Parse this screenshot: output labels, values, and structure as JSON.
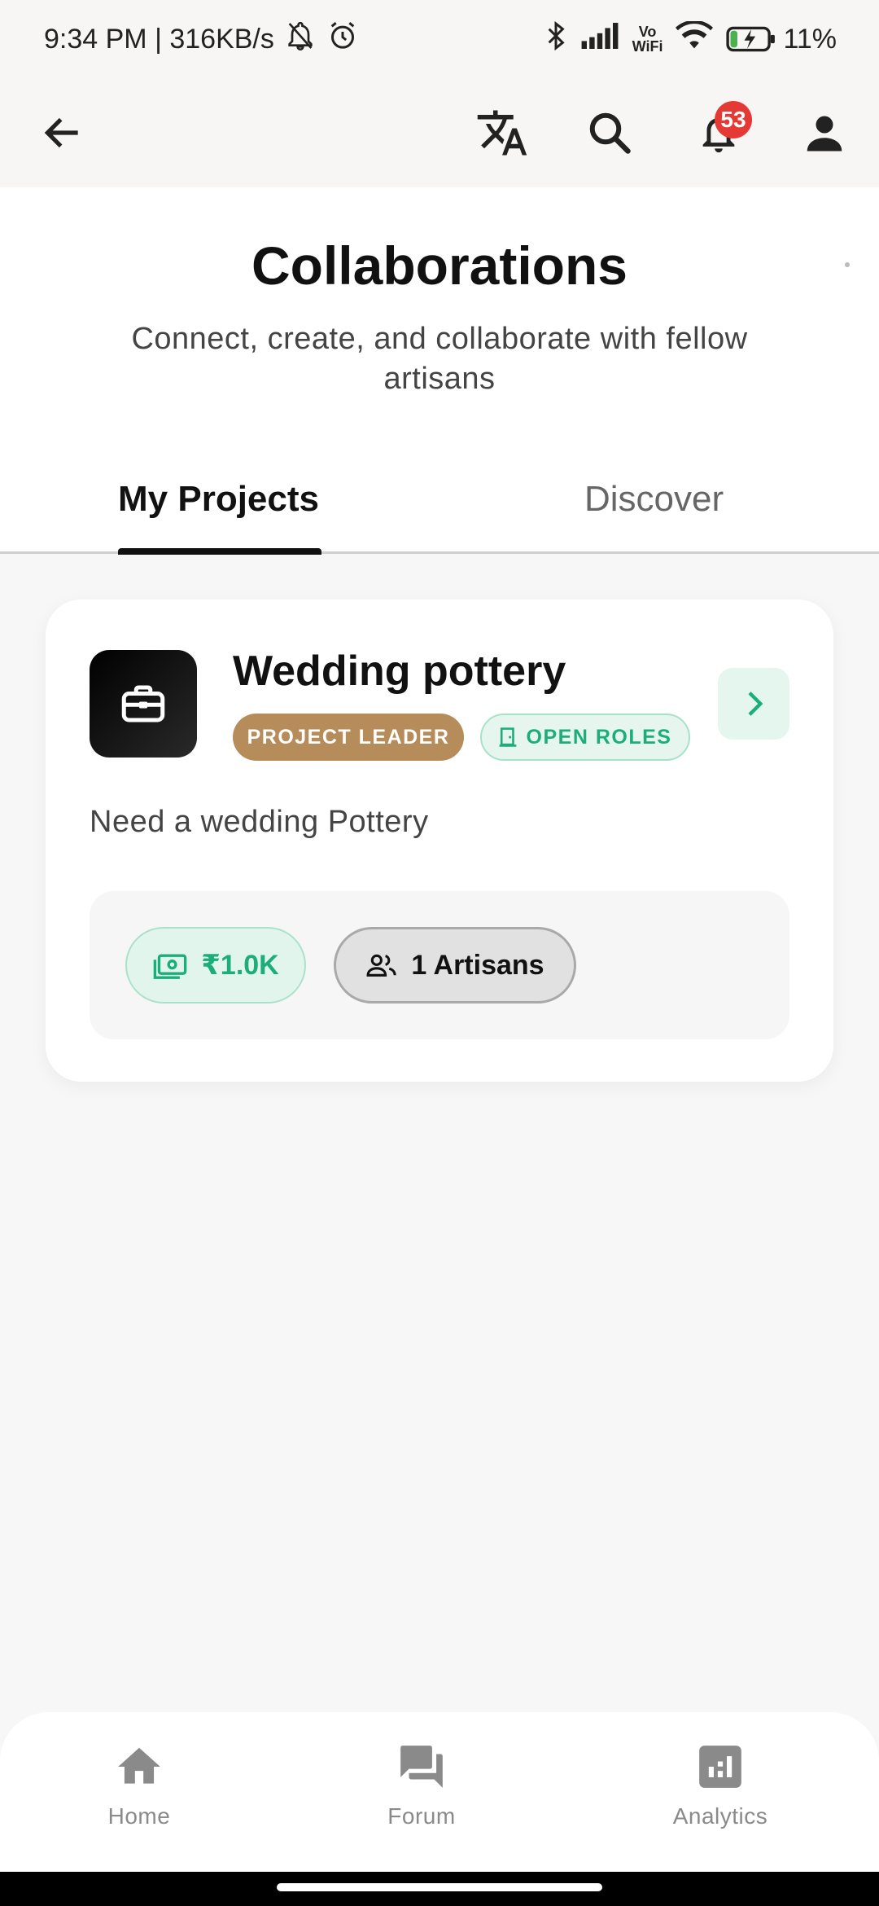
{
  "status_bar": {
    "time_speed": "9:34 PM | 316KB/s",
    "battery": "11%"
  },
  "app_bar": {
    "notification_count": "53",
    "icons": [
      "back-arrow-icon",
      "translate-icon",
      "search-icon",
      "bell-icon",
      "person-icon"
    ]
  },
  "header": {
    "title": "Collaborations",
    "subtitle": "Connect, create, and collaborate with fellow artisans"
  },
  "tabs": [
    {
      "label": "My Projects",
      "active": true
    },
    {
      "label": "Discover",
      "active": false
    }
  ],
  "project": {
    "title": "Wedding pottery",
    "role_badge": "PROJECT LEADER",
    "roles_badge": "OPEN ROLES",
    "description": "Need a wedding Pottery",
    "budget": "₹1.0K",
    "artisans": "1 Artisans"
  },
  "bottom_nav": [
    {
      "label": "Home",
      "icon": "home-icon"
    },
    {
      "label": "Forum",
      "icon": "forum-icon"
    },
    {
      "label": "Analytics",
      "icon": "analytics-icon"
    }
  ],
  "colors": {
    "leader_badge": "#b68d5a",
    "accent_green": "#1cae7a",
    "notification_badge": "#e53935"
  }
}
